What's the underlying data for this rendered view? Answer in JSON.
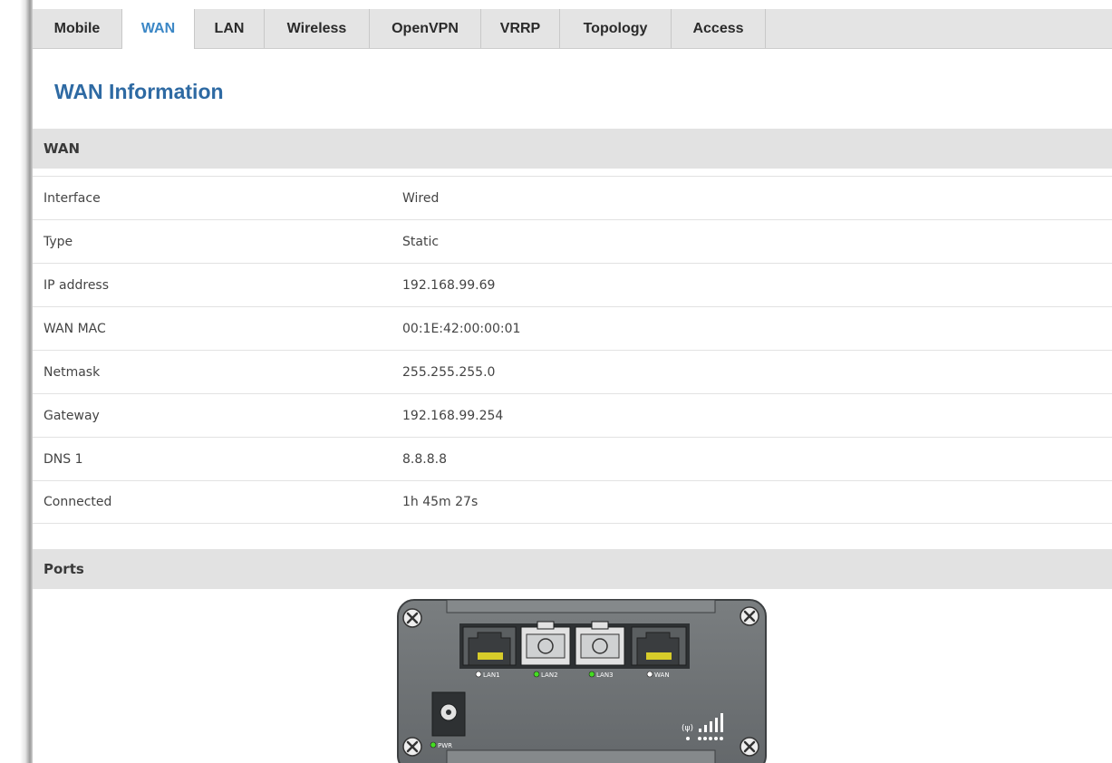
{
  "tabs": [
    {
      "label": "Mobile",
      "active": false
    },
    {
      "label": "WAN",
      "active": true
    },
    {
      "label": "LAN",
      "active": false
    },
    {
      "label": "Wireless",
      "active": false
    },
    {
      "label": "OpenVPN",
      "active": false
    },
    {
      "label": "VRRP",
      "active": false
    },
    {
      "label": "Topology",
      "active": false
    },
    {
      "label": "Access",
      "active": false
    }
  ],
  "page_title": "WAN Information",
  "wan_section": {
    "title": "WAN",
    "rows": [
      {
        "label": "Interface",
        "value": "Wired"
      },
      {
        "label": "Type",
        "value": "Static"
      },
      {
        "label": "IP address",
        "value": "192.168.99.69"
      },
      {
        "label": "WAN MAC",
        "value": "00:1E:42:00:00:01"
      },
      {
        "label": "Netmask",
        "value": "255.255.255.0"
      },
      {
        "label": "Gateway",
        "value": "192.168.99.254"
      },
      {
        "label": "DNS 1",
        "value": "8.8.8.8"
      },
      {
        "label": "Connected",
        "value": "1h 45m 27s"
      }
    ]
  },
  "ports_section": {
    "title": "Ports",
    "ports": [
      {
        "label": "LAN1",
        "status_color": "#ffffff"
      },
      {
        "label": "LAN2",
        "status_color": "#44dd22"
      },
      {
        "label": "LAN3",
        "status_color": "#44dd22"
      },
      {
        "label": "WAN",
        "status_color": "#ffffff"
      }
    ],
    "power_label": "PWR",
    "power_color": "#44dd22"
  },
  "colors": {
    "tab_active": "#3b87c6",
    "title": "#2e6aa3",
    "section_bg": "#e2e2e2",
    "device_body": "#6e7274"
  }
}
